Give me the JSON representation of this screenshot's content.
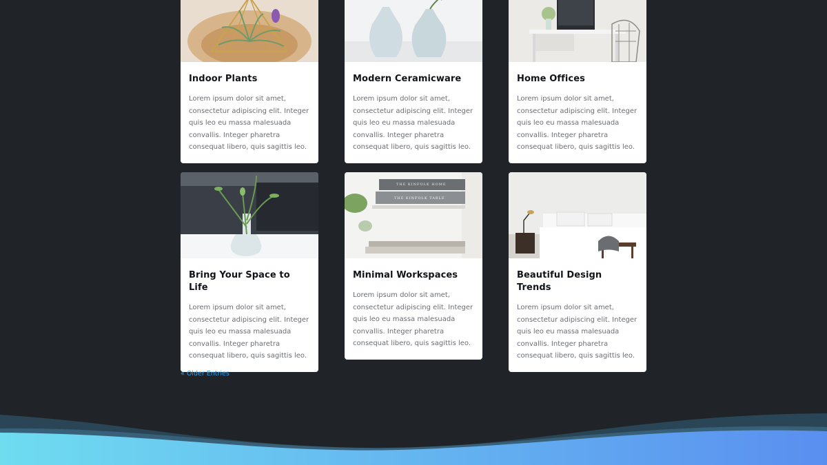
{
  "posts": [
    {
      "title": "Indoor Plants",
      "excerpt": "Lorem ipsum dolor sit amet, consectetur adipiscing elit. Integer quis leo eu massa malesuada convallis. Integer pharetra consequat libero, quis sagittis leo.",
      "image_icon": "air-plant-terrarium-image"
    },
    {
      "title": "Modern Ceramicware",
      "excerpt": "Lorem ipsum dolor sit amet, consectetur adipiscing elit. Integer quis leo eu massa malesuada convallis. Integer pharetra consequat libero, quis sagittis leo.",
      "image_icon": "ceramic-vases-image"
    },
    {
      "title": "Home Offices",
      "excerpt": "Lorem ipsum dolor sit amet, consectetur adipiscing elit. Integer quis leo eu massa malesuada convallis. Integer pharetra consequat libero, quis sagittis leo.",
      "image_icon": "desk-workspace-image"
    },
    {
      "title": "Bring Your Space to Life",
      "excerpt": "Lorem ipsum dolor sit amet, consectetur adipiscing elit. Integer quis leo eu massa malesuada convallis. Integer pharetra consequat libero, quis sagittis leo.",
      "image_icon": "glass-vase-plant-image"
    },
    {
      "title": "Minimal Workspaces",
      "excerpt": "Lorem ipsum dolor sit amet, consectetur adipiscing elit. Integer quis leo eu massa malesuada convallis. Integer pharetra consequat libero, quis sagittis leo.",
      "image_icon": "bookshelf-image",
      "image_text": [
        "THE KINFOLK HOME",
        "THE KINFOLK TABLE"
      ]
    },
    {
      "title": "Beautiful Design Trends",
      "excerpt": "Lorem ipsum dolor sit amet, consectetur adipiscing elit. Integer quis leo eu massa malesuada convallis. Integer pharetra consequat libero, quis sagittis leo.",
      "image_icon": "bedroom-image"
    }
  ],
  "pagination": {
    "older_label": "« Older Entries"
  },
  "colors": {
    "background": "#202327",
    "card": "#ffffff",
    "link": "#2ea3f2",
    "wave_start": "#6fdcf0",
    "wave_end": "#5a8ff0"
  }
}
